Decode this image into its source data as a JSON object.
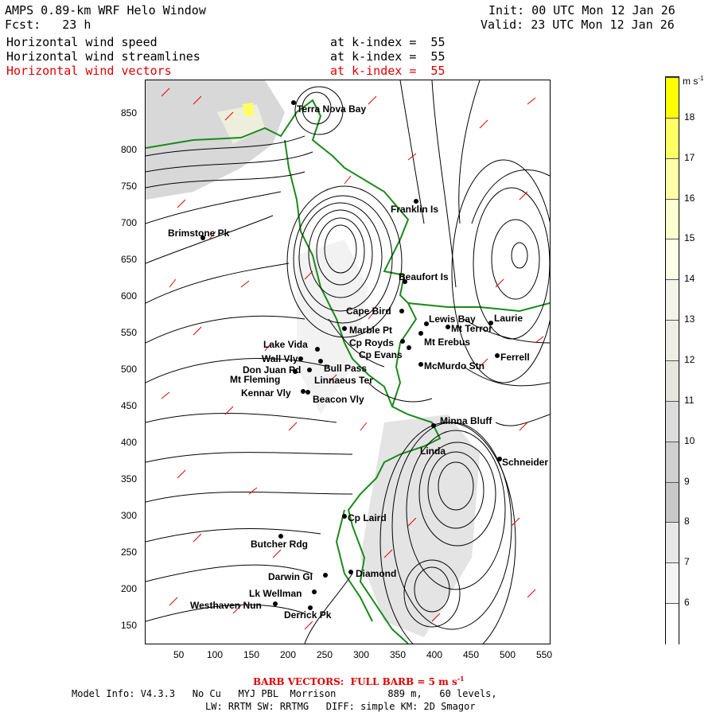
{
  "header": {
    "model_title": "AMPS 0.89-km WRF Helo Window",
    "forecast": "Fcst:   23 h",
    "init": "Init: 00 UTC Mon 12 Jan 26",
    "valid": "Valid: 23 UTC Mon 12 Jan 26",
    "fields": [
      {
        "name": "Horizontal wind speed",
        "level": "at k-index =  55"
      },
      {
        "name": "Horizontal wind streamlines",
        "level": "at k-index =  55"
      },
      {
        "name": "Horizontal wind vectors",
        "level": "at k-index =  55"
      }
    ]
  },
  "axes": {
    "x_ticks": [
      "50",
      "100",
      "150",
      "200",
      "250",
      "300",
      "350",
      "400",
      "450",
      "500",
      "550"
    ],
    "y_ticks": [
      "850",
      "800",
      "750",
      "700",
      "650",
      "600",
      "550",
      "500",
      "450",
      "400",
      "350",
      "300",
      "250",
      "200",
      "150"
    ]
  },
  "colorbar": {
    "unit": "m s",
    "unit_exp": "-1",
    "labels": [
      "18",
      "17",
      "16",
      "15",
      "14",
      "13",
      "12",
      "11",
      "10",
      "9",
      "8",
      "7",
      "6"
    ],
    "colors": [
      "#ffff00",
      "#ffff66",
      "#ffffa8",
      "#ffffd0",
      "#ffffe8",
      "#f4f4e8",
      "#eeeee4",
      "#e6e6dc",
      "#dcdcdc",
      "#d0d0d0",
      "#c8c8c8",
      "#e8e8e8",
      "#f4f4f4",
      "#ffffff"
    ]
  },
  "places": [
    {
      "name": "Terra Nova Bay"
    },
    {
      "name": "Franklin Is"
    },
    {
      "name": "Brimstone Pk"
    },
    {
      "name": "Beaufort Is"
    },
    {
      "name": "Cape Bird"
    },
    {
      "name": "Lewis Bay"
    },
    {
      "name": "Laurie"
    },
    {
      "name": "Mt Terror"
    },
    {
      "name": "Marble Pt"
    },
    {
      "name": "Cp Royds"
    },
    {
      "name": "Mt Erebus"
    },
    {
      "name": "Lake Vida"
    },
    {
      "name": "Cp Evans"
    },
    {
      "name": "Ferrell"
    },
    {
      "name": "Wall Vly"
    },
    {
      "name": "McMurdo Stn"
    },
    {
      "name": "Bull Pass"
    },
    {
      "name": "Don Juan Pd"
    },
    {
      "name": "Mt Fleming"
    },
    {
      "name": "Linnaeus Ter"
    },
    {
      "name": "Kennar Vly"
    },
    {
      "name": "Beacon Vly"
    },
    {
      "name": "Minna Bluff"
    },
    {
      "name": "Linda"
    },
    {
      "name": "Schneider"
    },
    {
      "name": "Cp Laird"
    },
    {
      "name": "Butcher Rdg"
    },
    {
      "name": "Darwin Gl"
    },
    {
      "name": "Diamond"
    },
    {
      "name": "Lk Wellman"
    },
    {
      "name": "Westhaven Nun"
    },
    {
      "name": "Derrick Pk"
    }
  ],
  "footer": {
    "barb_prefix": "BARB VECTORS:  FULL BARB = 5 m s",
    "barb_exp": "-1",
    "model_info": "Model Info: V4.3.3   No Cu   MYJ PBL  Morrison         889 m,   60 levels,",
    "physics": "LW: RRTM SW: RRTMG   DIFF: simple KM: 2D Smagor"
  }
}
